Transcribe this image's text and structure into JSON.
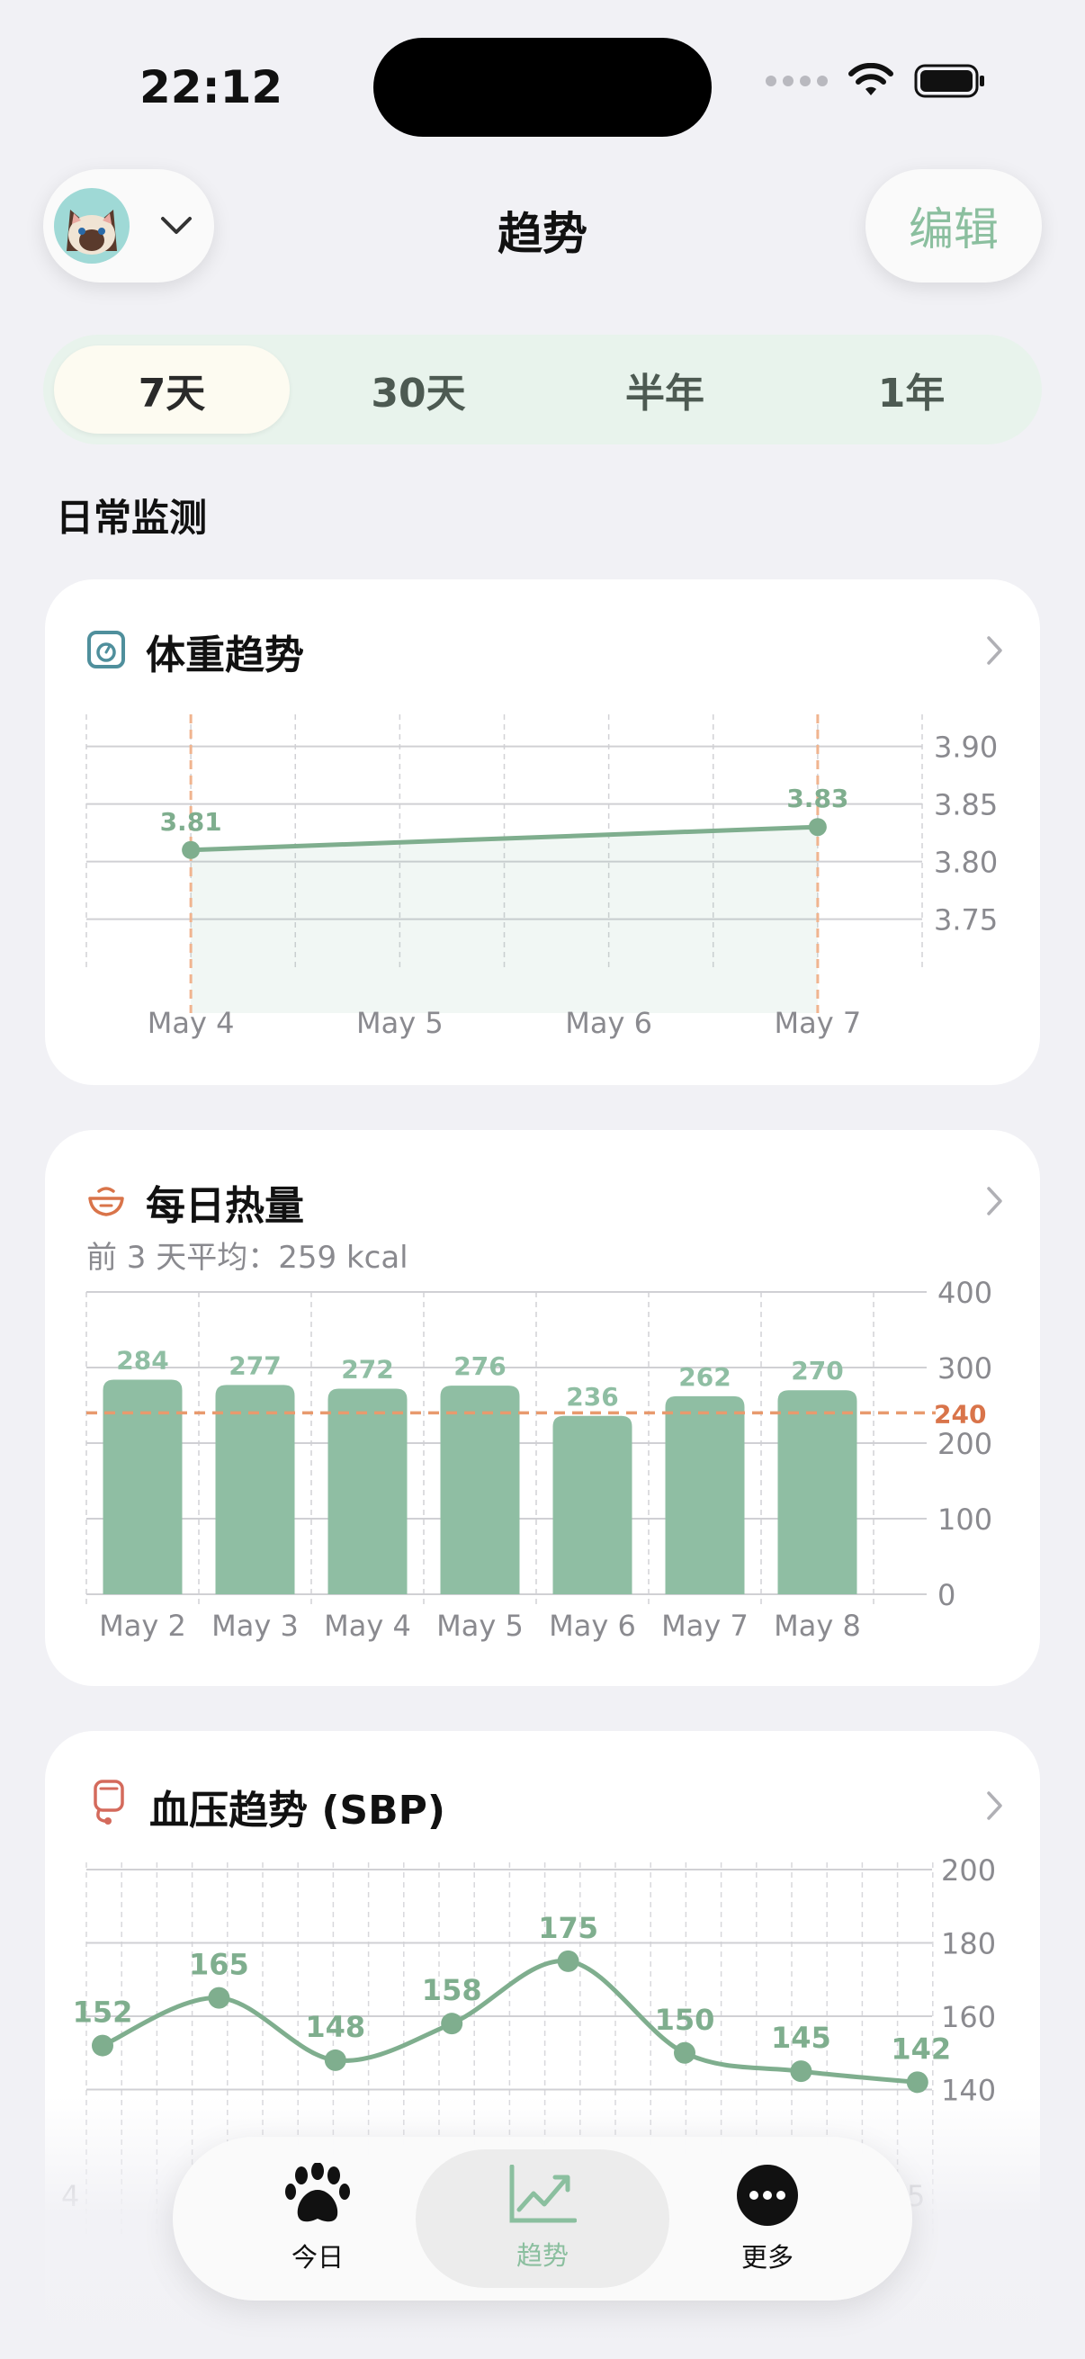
{
  "status_bar": {
    "time": "22:12"
  },
  "header": {
    "title": "趋势",
    "edit_label": "编辑"
  },
  "range_tabs": [
    {
      "label": "7天",
      "active": true
    },
    {
      "label": "30天",
      "active": false
    },
    {
      "label": "半年",
      "active": false
    },
    {
      "label": "1年",
      "active": false
    }
  ],
  "section": {
    "title": "日常监测"
  },
  "cards": {
    "weight": {
      "title": "体重趋势"
    },
    "calories": {
      "title": "每日热量",
      "subtitle": "前 3 天平均：259 kcal"
    },
    "bp": {
      "title": "血压趋势 (SBP)"
    }
  },
  "tabbar": [
    {
      "label": "今日",
      "icon": "paw-icon",
      "active": false
    },
    {
      "label": "趋势",
      "icon": "trend-chart-icon",
      "active": true
    },
    {
      "label": "更多",
      "icon": "more-icon",
      "active": false
    }
  ],
  "colors": {
    "accent": "#8bbf9f",
    "line": "#7fae8e",
    "bar": "#8fbea3",
    "goal": "#e89a6e"
  },
  "chart_data": [
    {
      "type": "line",
      "title": "体重趋势",
      "categories": [
        "May 4",
        "May 5",
        "May 6",
        "May 7"
      ],
      "points": [
        {
          "x": "May 4",
          "y": 3.81
        },
        {
          "x": "May 7",
          "y": 3.83
        }
      ],
      "yticks": [
        "3.90",
        "3.85",
        "3.80",
        "3.75"
      ],
      "ylim": [
        3.72,
        3.92
      ],
      "data_labels": [
        "3.81",
        "3.83"
      ]
    },
    {
      "type": "bar",
      "title": "每日热量",
      "categories": [
        "May 2",
        "May 3",
        "May 4",
        "May 5",
        "May 6",
        "May 7",
        "May 8"
      ],
      "values": [
        284,
        277,
        272,
        276,
        236,
        262,
        270
      ],
      "yticks": [
        "400",
        "300",
        "200",
        "100",
        "0"
      ],
      "ylim": [
        0,
        400
      ],
      "goal": {
        "value": 240,
        "label": "240"
      }
    },
    {
      "type": "line",
      "title": "血压趋势 (SBP)",
      "values": [
        152,
        165,
        148,
        158,
        175,
        150,
        145,
        142
      ],
      "yticks": [
        "200",
        "180",
        "160",
        "140"
      ],
      "ylim": [
        120,
        200
      ],
      "xlabels": [
        "4",
        "5"
      ]
    }
  ]
}
